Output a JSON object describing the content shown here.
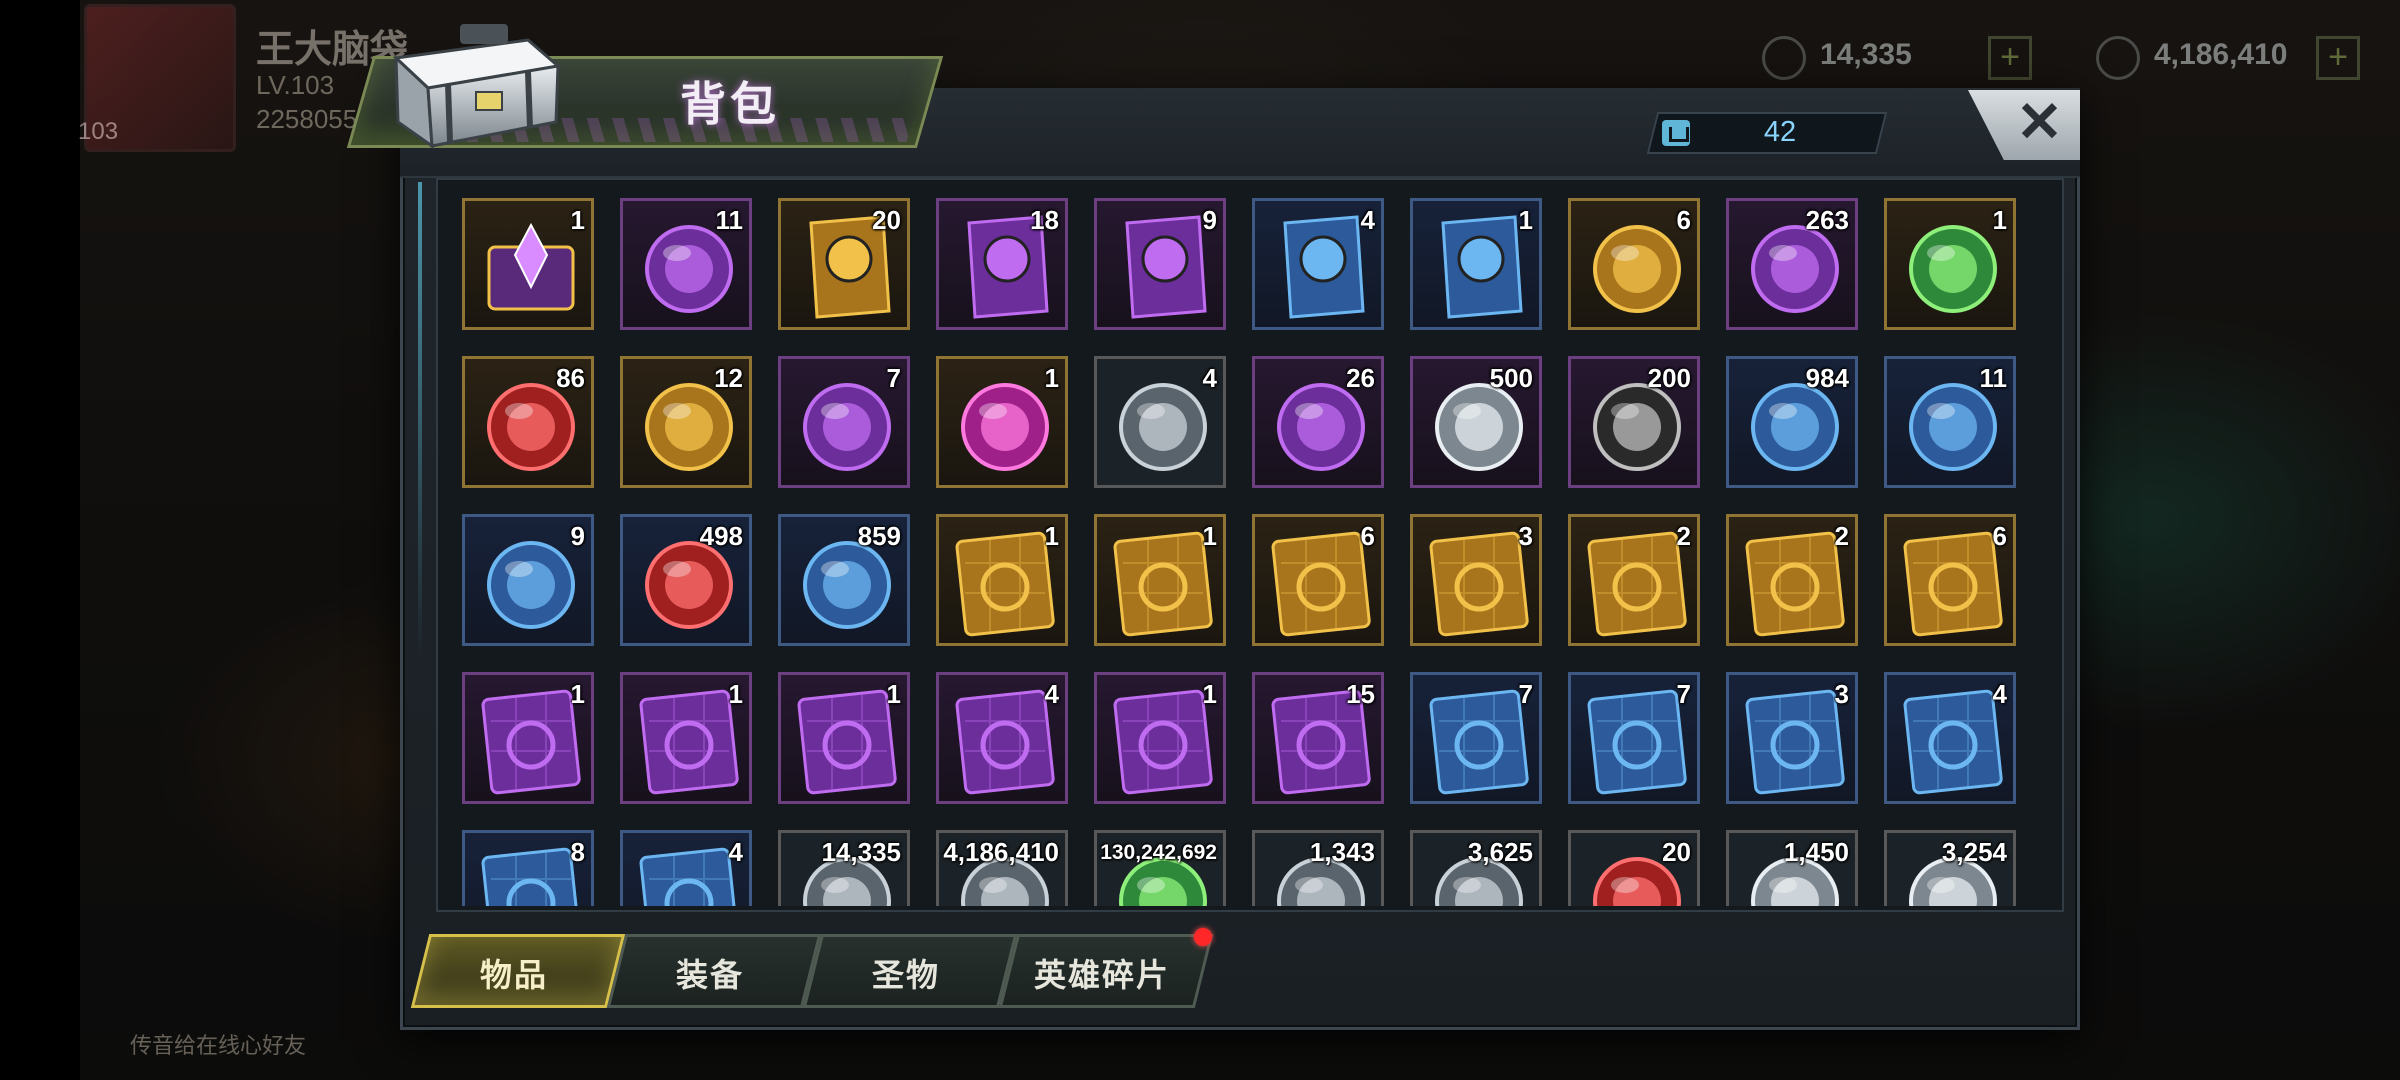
{
  "hud": {
    "player_name": "王大脑袋",
    "player_level": "LV.103",
    "player_power": "2258055",
    "level_badge": "103",
    "resource_1": "14,335",
    "resource_2": "4,186,410"
  },
  "chat_hint": "传音给在线心好友",
  "panel": {
    "title": "背包",
    "capacity": "42"
  },
  "items": [
    {
      "count": "1",
      "icon": "purple-gem-chest-lv1-icon",
      "rarity": "gold"
    },
    {
      "count": "11",
      "icon": "blue-swap-capsule-icon",
      "rarity": "purple"
    },
    {
      "count": "20",
      "icon": "gold-coin-card-24h-icon",
      "rarity": "gold"
    },
    {
      "count": "18",
      "icon": "cyan-coin-card-12h-icon",
      "rarity": "purple"
    },
    {
      "count": "9",
      "icon": "gold-coin-card-12h-icon",
      "rarity": "purple"
    },
    {
      "count": "4",
      "icon": "cyan-coin-card-4h-icon",
      "rarity": "blue"
    },
    {
      "count": "1",
      "icon": "gold-coin-card-4h-icon",
      "rarity": "blue"
    },
    {
      "count": "6",
      "icon": "golden-skull-icon",
      "rarity": "gold"
    },
    {
      "count": "263",
      "icon": "rose-dome-icon",
      "rarity": "purple"
    },
    {
      "count": "1",
      "icon": "green-leaf-orb-icon",
      "rarity": "gold"
    },
    {
      "count": "86",
      "icon": "red-lips-bottlecap-icon",
      "rarity": "gold"
    },
    {
      "count": "12",
      "icon": "gold-bonus-coin-icon",
      "rarity": "gold"
    },
    {
      "count": "7",
      "icon": "film-reel-icon",
      "rarity": "purple"
    },
    {
      "count": "1",
      "icon": "pink-neon-bottlecap-icon",
      "rarity": "gold"
    },
    {
      "count": "4",
      "icon": "purple-casino-chip-icon",
      "rarity": "default"
    },
    {
      "count": "26",
      "icon": "police-badge-icon",
      "rarity": "purple"
    },
    {
      "count": "500",
      "icon": "silver-bonus-coin-icon",
      "rarity": "purple"
    },
    {
      "count": "200",
      "icon": "black-heart-chip-icon",
      "rarity": "purple"
    },
    {
      "count": "984",
      "icon": "cinema-ticket-icon",
      "rarity": "blue"
    },
    {
      "count": "11",
      "icon": "blue-timer-coin-icon",
      "rarity": "blue"
    },
    {
      "count": "9",
      "icon": "blue-b-bottlecap-icon",
      "rarity": "blue"
    },
    {
      "count": "498",
      "icon": "red-spade-chip-icon",
      "rarity": "blue"
    },
    {
      "count": "859",
      "icon": "golden-bullet-icon",
      "rarity": "blue"
    },
    {
      "count": "1",
      "icon": "gold-blueprint-shirt-icon",
      "rarity": "gold"
    },
    {
      "count": "1",
      "icon": "gold-blueprint-shirt-icon",
      "rarity": "gold"
    },
    {
      "count": "6",
      "icon": "gold-blueprint-heart-icon",
      "rarity": "gold"
    },
    {
      "count": "3",
      "icon": "gold-blueprint-boot-icon",
      "rarity": "gold"
    },
    {
      "count": "2",
      "icon": "gold-blueprint-hat-icon",
      "rarity": "gold"
    },
    {
      "count": "2",
      "icon": "gold-blueprint-revolver-icon",
      "rarity": "gold"
    },
    {
      "count": "6",
      "icon": "gold-blueprint-swords-icon",
      "rarity": "gold"
    },
    {
      "count": "1",
      "icon": "purple-blueprint-heart-icon",
      "rarity": "purple"
    },
    {
      "count": "1",
      "icon": "purple-blueprint-boot-icon",
      "rarity": "purple"
    },
    {
      "count": "1",
      "icon": "purple-blueprint-shirt-icon",
      "rarity": "purple"
    },
    {
      "count": "4",
      "icon": "purple-blueprint-revolver-icon",
      "rarity": "purple"
    },
    {
      "count": "1",
      "icon": "purple-blueprint-hat-icon",
      "rarity": "purple"
    },
    {
      "count": "15",
      "icon": "purple-blueprint-shirt-icon",
      "rarity": "purple"
    },
    {
      "count": "7",
      "icon": "blue-blueprint-swords-icon",
      "rarity": "blue"
    },
    {
      "count": "7",
      "icon": "blue-blueprint-boot-icon",
      "rarity": "blue"
    },
    {
      "count": "3",
      "icon": "blue-blueprint-heart-icon",
      "rarity": "blue"
    },
    {
      "count": "4",
      "icon": "blue-blueprint-hat-icon",
      "rarity": "blue"
    },
    {
      "count": "8",
      "icon": "blue-blueprint-shirt-icon",
      "rarity": "blue"
    },
    {
      "count": "4",
      "icon": "blue-blueprint-revolver-icon",
      "rarity": "blue"
    },
    {
      "count": "14,335",
      "icon": "purple-crystal-icon",
      "rarity": "default"
    },
    {
      "count": "4,186,410",
      "icon": "gold-coin-pile-icon",
      "rarity": "default"
    },
    {
      "count": "130,242,692",
      "icon": "green-battery-icon",
      "rarity": "default"
    },
    {
      "count": "1,343",
      "icon": "purple-potion-icon",
      "rarity": "default"
    },
    {
      "count": "3,625",
      "icon": "gear-parts-icon",
      "rarity": "default"
    },
    {
      "count": "20",
      "icon": "red-network-orb-icon",
      "rarity": "default"
    },
    {
      "count": "1,450",
      "icon": "silver-drone-icon",
      "rarity": "default"
    },
    {
      "count": "3,254",
      "icon": "white-arrow-emblem-icon",
      "rarity": "default"
    }
  ],
  "tabs": [
    {
      "label": "物品",
      "active": true
    },
    {
      "label": "装备",
      "active": false
    },
    {
      "label": "圣物",
      "active": false
    },
    {
      "label": "英雄碎片",
      "active": false
    }
  ],
  "colors": {
    "gold_frame": "#8f7434",
    "purple_frame": "#6c3f80",
    "blue_frame": "#3e5a84",
    "active_tab": "#d6c04a",
    "notification": "#ff2727"
  }
}
